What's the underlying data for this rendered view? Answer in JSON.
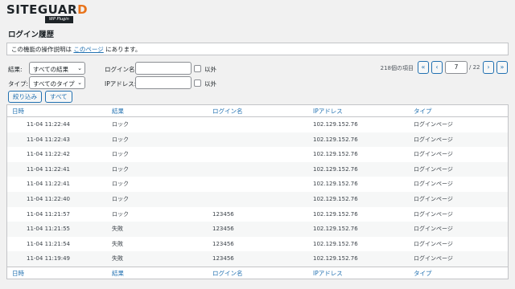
{
  "logo": {
    "main_prefix": "SITEGUAR",
    "main_suffix": "D",
    "sub": "WP Plugin"
  },
  "page_title": "ログイン履歴",
  "notice": {
    "prefix": "この機能の操作説明は ",
    "link": "このページ",
    "suffix": " にあります。"
  },
  "filters": {
    "result_label": "結果:",
    "result_value": "すべての結果",
    "type_label": "タイプ:",
    "type_value": "すべてのタイプ",
    "login_label": "ログイン名:",
    "ip_label": "IPアドレス:",
    "exclude_label": "以外",
    "filter_button": "絞り込み",
    "all_button": "すべて"
  },
  "pagination": {
    "count": "218個の項目",
    "first": "«",
    "prev": "‹",
    "current": "7",
    "total": "/ 22",
    "next": "›",
    "last": "»"
  },
  "table": {
    "headers": [
      "日時",
      "結果",
      "ログイン名",
      "IPアドレス",
      "タイプ"
    ],
    "rows": [
      [
        "11-04 11:22:44",
        "ロック",
        "",
        "102.129.152.76",
        "ログインページ"
      ],
      [
        "11-04 11:22:43",
        "ロック",
        "",
        "102.129.152.76",
        "ログインページ"
      ],
      [
        "11-04 11:22:42",
        "ロック",
        "",
        "102.129.152.76",
        "ログインページ"
      ],
      [
        "11-04 11:22:41",
        "ロック",
        "",
        "102.129.152.76",
        "ログインページ"
      ],
      [
        "11-04 11:22:41",
        "ロック",
        "",
        "102.129.152.76",
        "ログインページ"
      ],
      [
        "11-04 11:22:40",
        "ロック",
        "",
        "102.129.152.76",
        "ログインページ"
      ],
      [
        "11-04 11:21:57",
        "ロック",
        "123456",
        "102.129.152.76",
        "ログインページ"
      ],
      [
        "11-04 11:21:55",
        "失敗",
        "123456",
        "102.129.152.76",
        "ログインページ"
      ],
      [
        "11-04 11:21:54",
        "失敗",
        "123456",
        "102.129.152.76",
        "ログインページ"
      ],
      [
        "11-04 11:19:49",
        "失敗",
        "123456",
        "102.129.152.76",
        "ログインページ"
      ]
    ]
  }
}
